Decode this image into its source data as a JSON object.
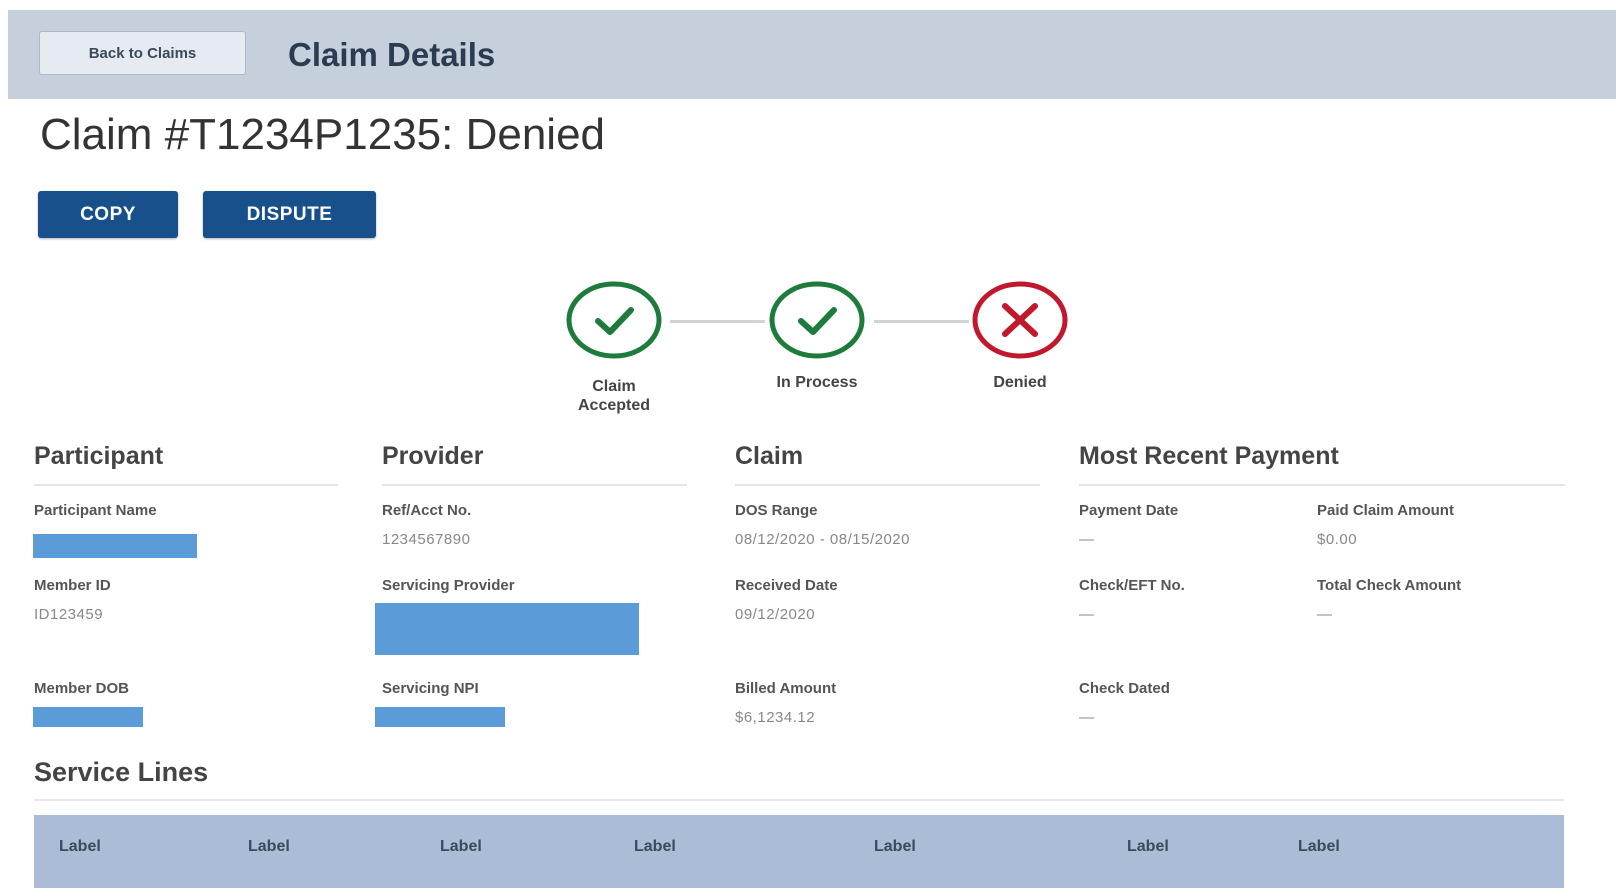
{
  "header": {
    "back_label": "Back to Claims",
    "title": "Claim Details"
  },
  "claim": {
    "title": "Claim #T1234P1235: Denied"
  },
  "actions": {
    "copy": "COPY",
    "dispute": "DISPUTE"
  },
  "progress": {
    "steps": [
      {
        "label": "Claim\nAccepted",
        "status": "complete"
      },
      {
        "label": "In Process",
        "status": "complete"
      },
      {
        "label": "Denied",
        "status": "failed"
      }
    ]
  },
  "participant": {
    "title": "Participant",
    "name_label": "Participant Name",
    "member_id_label": "Member ID",
    "member_id": "ID123459",
    "dob_label": "Member DOB"
  },
  "provider": {
    "title": "Provider",
    "ref_label": "Ref/Acct No.",
    "ref_value": "1234567890",
    "servicing_label": "Servicing Provider",
    "npi_label": "Servicing NPI"
  },
  "claim_info": {
    "title": "Claim",
    "dos_label": "DOS Range",
    "dos_value": "08/12/2020 - 08/15/2020",
    "received_label": "Received Date",
    "received_value": "09/12/2020",
    "billed_label": "Billed Amount",
    "billed_value": "$6,1234.12"
  },
  "payment": {
    "title": "Most Recent Payment",
    "date_label": "Payment Date",
    "date_value": "—",
    "paid_label": "Paid Claim Amount",
    "paid_value": "$0.00",
    "check_label": "Check/EFT No.",
    "check_value": "—",
    "total_label": "Total Check Amount",
    "total_value": "—",
    "dated_label": "Check Dated",
    "dated_value": "—"
  },
  "service_lines": {
    "title": "Service Lines",
    "columns": [
      "Label",
      "Label",
      "Label",
      "Label",
      "Label",
      "Label",
      "Label"
    ]
  },
  "colors": {
    "header_bg": "#c6d0dc",
    "primary": "#17508a",
    "success": "#1e7b3c",
    "error": "#c0182d",
    "redaction": "#5b9bd8"
  }
}
